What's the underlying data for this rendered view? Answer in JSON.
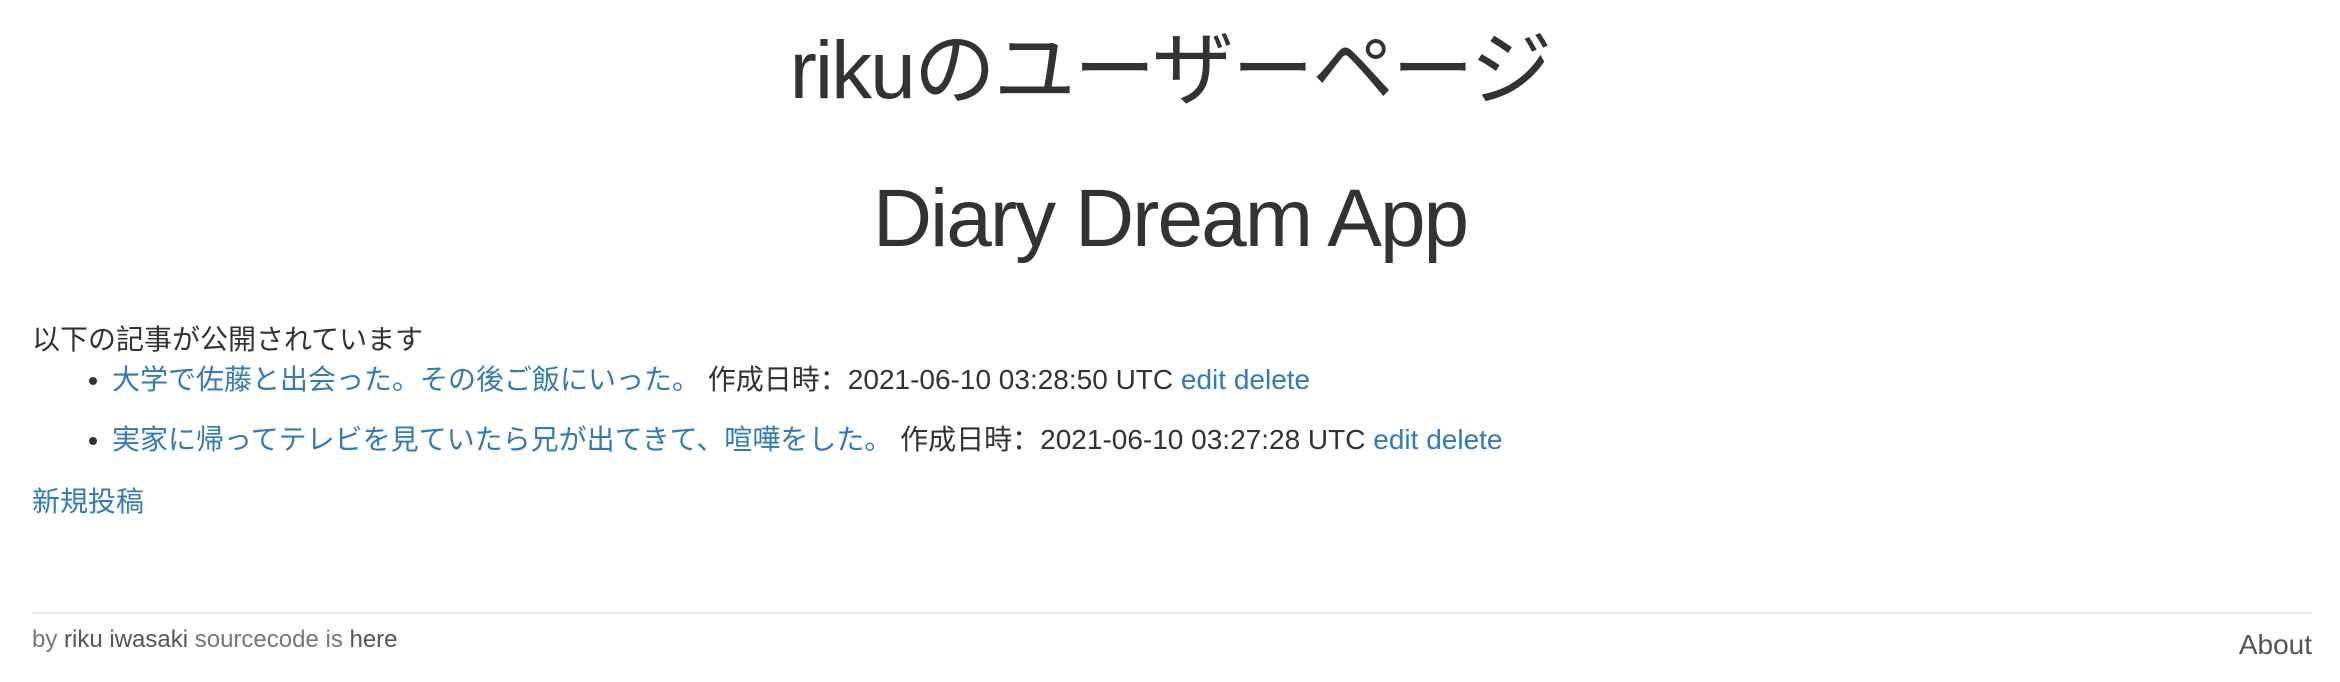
{
  "header": {
    "user_page_title": "rikuのユーザーページ",
    "app_title": "Diary Dream App"
  },
  "main": {
    "intro": "以下の記事が公開されています",
    "posts": [
      {
        "title": "大学で佐藤と出会った。その後ご飯にいった。",
        "meta": "作成日時：2021-06-10 03:28:50 UTC",
        "edit_label": "edit",
        "delete_label": "delete"
      },
      {
        "title": "実家に帰ってテレビを見ていたら兄が出てきて、喧嘩をした。",
        "meta": "作成日時：2021-06-10 03:27:28 UTC",
        "edit_label": "edit",
        "delete_label": "delete"
      }
    ],
    "new_post_label": "新規投稿"
  },
  "footer": {
    "by": "by",
    "author": "riku iwasaki",
    "sourcecode_text": "sourcecode is",
    "here_label": "here",
    "about_label": "About"
  },
  "colors": {
    "link": "#337ab7",
    "text": "#333333",
    "muted": "#777777"
  }
}
